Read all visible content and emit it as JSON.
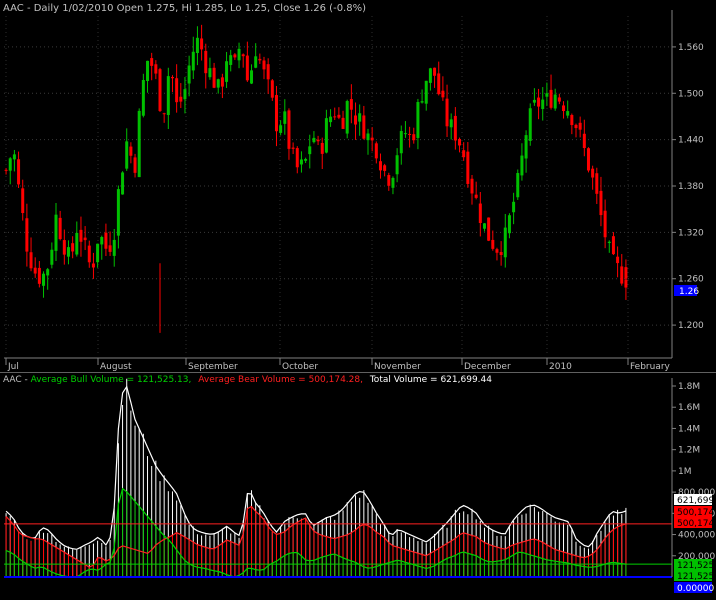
{
  "colors": {
    "background": "#000000",
    "up_candle": "#00c000",
    "down_candle": "#ff0000",
    "bull_volume": "#00c000",
    "bear_volume": "#ff0000",
    "total_volume": "#ffffff",
    "avg_bull_line": "#00d000",
    "avg_bear_line": "#ff2020",
    "label_text": "#c0c0c0",
    "last_price_box": "#0000ff",
    "zero_line": "#0000ff"
  },
  "price_panel": {
    "header": "AAC - Daily 1/02/2010 Open 1.275, Hi 1.285, Lo 1.25, Close 1.26 (-0.8%)",
    "last_price_label": "1.26"
  },
  "volume_panel": {
    "header_prefix": "AAC - ",
    "header_bull": "Average Bull Volume = 121,525.13,",
    "header_bear": "Average Bear Volume = 500,174.28,",
    "header_total": "Total Volume = 621,699.44",
    "tag_total": "621,699",
    "tag_bear_1": "500,174",
    "tag_bear_2": "500,174",
    "tag_bull_1": "121,525",
    "tag_bull_2": "121,525",
    "tag_zero": "0.00000"
  },
  "chart_data": [
    {
      "type": "candlestick",
      "title": "AAC - Daily 1/02/2010 Open 1.275, Hi 1.285, Lo 1.25, Close 1.26 (-0.8%)",
      "ylim": [
        1.16,
        1.6
      ],
      "y_ticks": [
        1.2,
        1.26,
        1.32,
        1.38,
        1.44,
        1.5,
        1.56
      ],
      "y_tick_labels": [
        "1.200",
        "1.260",
        "1.320",
        "1.380",
        "1.440",
        "1.500",
        "1.560"
      ],
      "x_labels": [
        "Jul",
        "August",
        "September",
        "October",
        "November",
        "December",
        "2010",
        "February"
      ],
      "grid": true,
      "close_path": [
        1.4,
        1.43,
        1.36,
        1.3,
        1.27,
        1.26,
        1.28,
        1.34,
        1.31,
        1.28,
        1.33,
        1.3,
        1.27,
        1.32,
        1.3,
        1.31,
        1.39,
        1.44,
        1.4,
        1.5,
        1.55,
        1.52,
        1.47,
        1.54,
        1.48,
        1.5,
        1.55,
        1.57,
        1.54,
        1.52,
        1.5,
        1.55,
        1.53,
        1.57,
        1.51,
        1.56,
        1.53,
        1.5,
        1.46,
        1.47,
        1.42,
        1.4,
        1.41,
        1.45,
        1.42,
        1.46,
        1.48,
        1.46,
        1.49,
        1.47,
        1.46,
        1.44,
        1.43,
        1.4,
        1.39,
        1.43,
        1.45,
        1.44,
        1.49,
        1.52,
        1.53,
        1.49,
        1.46,
        1.45,
        1.43,
        1.39,
        1.36,
        1.33,
        1.31,
        1.3,
        1.31,
        1.35,
        1.39,
        1.45,
        1.48,
        1.49,
        1.49,
        1.5,
        1.49,
        1.48,
        1.46,
        1.43,
        1.4,
        1.36,
        1.32,
        1.28,
        1.27,
        1.26
      ],
      "last": {
        "open": 1.275,
        "high": 1.285,
        "low": 1.25,
        "close": 1.26
      }
    },
    {
      "type": "bar",
      "title": "AAC - Average Bull Volume = 121,525.13, Average Bear Volume = 500,174.28, Total Volume = 621,699.44",
      "ylim": [
        0,
        1800000
      ],
      "y_ticks": [
        200000,
        400000,
        600000,
        800000,
        1000000,
        1200000,
        1400000,
        1600000,
        1800000
      ],
      "y_tick_labels": [
        "200,000",
        "400,000",
        "600,000",
        "800,000",
        "1M",
        "1.2M",
        "1.4M",
        "1.6M",
        "1.8M"
      ],
      "series": [
        {
          "name": "Average Bull Volume",
          "last": 121525.13
        },
        {
          "name": "Average Bear Volume",
          "last": 500174.28
        },
        {
          "name": "Total Volume",
          "last": 621699.44
        }
      ],
      "total_path": [
        620000,
        560000,
        430000,
        380000,
        360000,
        470000,
        440000,
        360000,
        300000,
        270000,
        260000,
        300000,
        330000,
        380000,
        300000,
        420000,
        1700000,
        1800000,
        1500000,
        1350000,
        1200000,
        1050000,
        950000,
        870000,
        780000,
        600000,
        470000,
        430000,
        410000,
        400000,
        430000,
        480000,
        420000,
        380000,
        850000,
        700000,
        620000,
        500000,
        420000,
        520000,
        560000,
        590000,
        600000,
        480000,
        520000,
        560000,
        580000,
        620000,
        700000,
        780000,
        820000,
        720000,
        600000,
        500000,
        380000,
        450000,
        420000,
        390000,
        360000,
        330000,
        380000,
        450000,
        520000,
        600000,
        680000,
        650000,
        600000,
        500000,
        450000,
        420000,
        400000,
        520000,
        600000,
        660000,
        680000,
        650000,
        600000,
        560000,
        540000,
        520000,
        360000,
        300000,
        280000,
        420000,
        520000,
        620000,
        600000,
        622000
      ],
      "bull_path": [
        250000,
        220000,
        160000,
        120000,
        80000,
        100000,
        60000,
        30000,
        10000,
        0,
        0,
        50000,
        80000,
        60000,
        120000,
        150000,
        850000,
        800000,
        720000,
        640000,
        560000,
        480000,
        400000,
        340000,
        250000,
        160000,
        110000,
        90000,
        80000,
        60000,
        50000,
        20000,
        0,
        20000,
        90000,
        70000,
        60000,
        120000,
        150000,
        200000,
        230000,
        230000,
        160000,
        150000,
        180000,
        200000,
        220000,
        190000,
        160000,
        140000,
        100000,
        80000,
        100000,
        120000,
        140000,
        160000,
        140000,
        120000,
        100000,
        80000,
        100000,
        140000,
        180000,
        200000,
        240000,
        220000,
        200000,
        160000,
        140000,
        150000,
        160000,
        200000,
        240000,
        220000,
        200000,
        180000,
        160000,
        150000,
        140000,
        130000,
        110000,
        100000,
        90000,
        100000,
        120000,
        140000,
        130000,
        121500
      ],
      "bear_path": [
        570000,
        500000,
        400000,
        380000,
        360000,
        360000,
        320000,
        280000,
        240000,
        200000,
        160000,
        120000,
        80000,
        200000,
        150000,
        180000,
        300000,
        280000,
        260000,
        240000,
        220000,
        300000,
        350000,
        380000,
        420000,
        380000,
        340000,
        300000,
        280000,
        260000,
        300000,
        350000,
        320000,
        290000,
        700000,
        620000,
        560000,
        450000,
        400000,
        420000,
        480000,
        520000,
        560000,
        440000,
        400000,
        380000,
        360000,
        380000,
        400000,
        440000,
        500000,
        480000,
        420000,
        380000,
        300000,
        280000,
        260000,
        240000,
        220000,
        200000,
        240000,
        280000,
        320000,
        360000,
        420000,
        400000,
        380000,
        330000,
        300000,
        280000,
        260000,
        300000,
        320000,
        340000,
        360000,
        340000,
        300000,
        260000,
        240000,
        220000,
        200000,
        180000,
        200000,
        260000,
        360000,
        440000,
        480000,
        500174
      ]
    }
  ]
}
